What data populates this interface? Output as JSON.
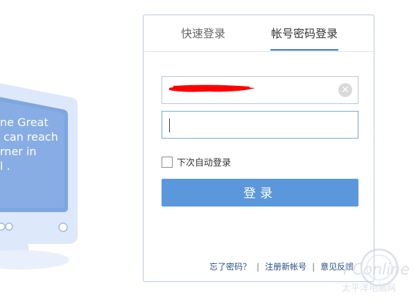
{
  "illustration": {
    "monitor_text": "ne Great\n can reach\nrner in\nl ."
  },
  "tabs": [
    {
      "label": "快速登录",
      "active": false
    },
    {
      "label": "帐号密码登录",
      "active": true
    }
  ],
  "form": {
    "username": {
      "value": "",
      "placeholder": ""
    },
    "password": {
      "value": "",
      "placeholder": ""
    },
    "auto_login_label": "下次自动登录",
    "login_button_label": "登录"
  },
  "links": [
    {
      "label": "忘了密码？"
    },
    {
      "label": "注册新帐号"
    },
    {
      "label": "意见反馈"
    }
  ],
  "separator": "|",
  "watermark": {
    "text_primary": "PConline",
    "text_secondary": "太平洋电脑网"
  },
  "colors": {
    "accent": "#2e6fd0",
    "button": "#5b97db",
    "card_border": "#b9c8dd",
    "monitor": "#dfe9fb"
  }
}
